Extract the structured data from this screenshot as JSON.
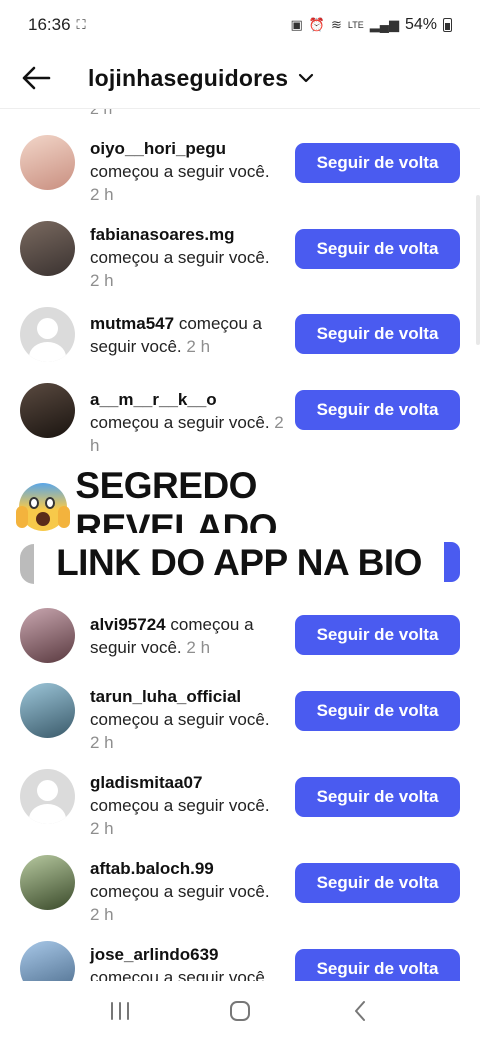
{
  "status": {
    "time": "16:36",
    "battery": "54%",
    "network": "LTE"
  },
  "header": {
    "title": "lojinhaseguidores"
  },
  "peek_time": "2 h",
  "follow_label": "Seguir de volta",
  "notifications": [
    {
      "username": "oiyo__hori_pegu",
      "action": "começou a seguir você.",
      "time": "2 h",
      "avatar": "photo",
      "avatar_colors": [
        "#f2d6c9",
        "#c98f80"
      ]
    },
    {
      "username": "fabianasoares.mg",
      "action": "começou a seguir você.",
      "time": "2 h",
      "avatar": "photo",
      "avatar_colors": [
        "#7a6a60",
        "#3a3230"
      ]
    },
    {
      "username": "mutma547",
      "action": "começou a seguir você.",
      "time": "2 h",
      "avatar": "default"
    },
    {
      "username": "a__m__r__k__o",
      "action": "começou a seguir você.",
      "time": "2 h",
      "avatar": "photo",
      "avatar_colors": [
        "#5a4a40",
        "#1a1410"
      ]
    },
    {
      "username": "alvi95724",
      "action": "começou a seguir você.",
      "time": "2 h",
      "avatar": "photo",
      "avatar_colors": [
        "#c9a7b0",
        "#5a3a40"
      ]
    },
    {
      "username": "tarun_luha_official",
      "action": "começou a seguir você.",
      "time": "2 h",
      "avatar": "photo",
      "avatar_colors": [
        "#9dc6d9",
        "#3a5a6a"
      ]
    },
    {
      "username": "gladismitaa07",
      "action": "começou a seguir você.",
      "time": "2 h",
      "avatar": "default"
    },
    {
      "username": "aftab.baloch.99",
      "action": "começou a seguir você.",
      "time": "2 h",
      "avatar": "photo",
      "avatar_colors": [
        "#b7c9a0",
        "#3a4a2a"
      ]
    },
    {
      "username": "jose_arlindo639",
      "action": "começou a seguir você.",
      "time": "",
      "avatar": "photo",
      "avatar_colors": [
        "#a8c8e8",
        "#4a6a8a"
      ]
    }
  ],
  "overlay": {
    "emoji": "face-screaming-in-fear",
    "line1": "SEGREDO REVELADO",
    "line2": "LINK DO APP NA BIO"
  }
}
